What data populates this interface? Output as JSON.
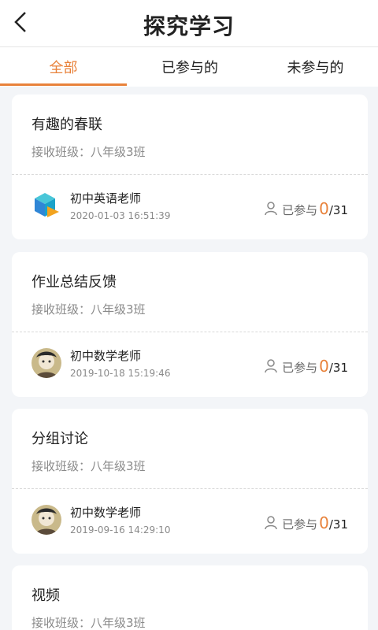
{
  "header": {
    "title": "探究学习"
  },
  "tabs": [
    {
      "label": "全部",
      "active": true
    },
    {
      "label": "已参与的",
      "active": false
    },
    {
      "label": "未参与的",
      "active": false
    }
  ],
  "cards": [
    {
      "title": "有趣的春联",
      "class_label": "接收班级：八年级3班",
      "teacher": "初中英语老师",
      "time": "2020-01-03 16:51:39",
      "participated_label": "已参与",
      "participated": "0",
      "total": "/31",
      "avatar": "cube-logo-icon"
    },
    {
      "title": "作业总结反馈",
      "class_label": "接收班级：八年级3班",
      "teacher": "初中数学老师",
      "time": "2019-10-18 15:19:46",
      "participated_label": "已参与",
      "participated": "0",
      "total": "/31",
      "avatar": "photo-avatar"
    },
    {
      "title": "分组讨论",
      "class_label": "接收班级：八年级3班",
      "teacher": "初中数学老师",
      "time": "2019-09-16 14:29:10",
      "participated_label": "已参与",
      "participated": "0",
      "total": "/31",
      "avatar": "photo-avatar"
    },
    {
      "title": "视频",
      "class_label": "接收班级：八年级3班"
    }
  ],
  "colors": {
    "accent": "#e8823b",
    "background": "#f3f5f8",
    "muted_text": "#8a8a8a"
  }
}
